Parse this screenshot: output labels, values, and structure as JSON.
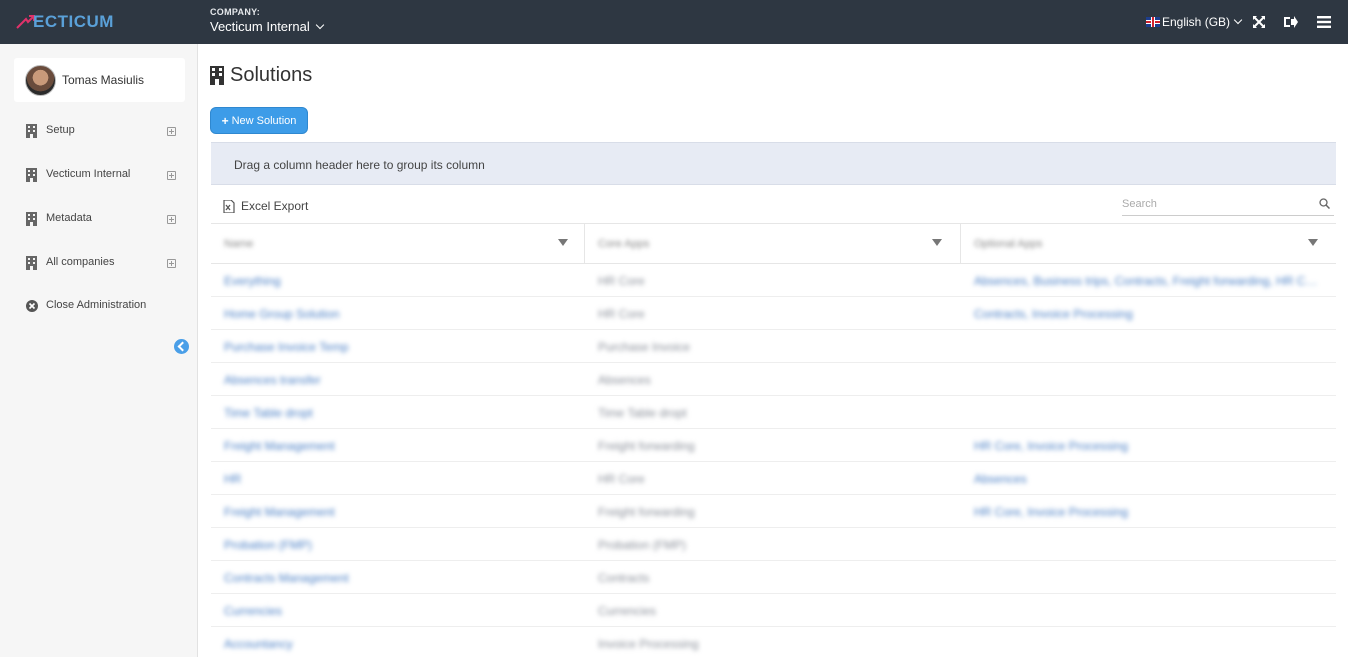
{
  "topbar": {
    "logo_text": "ECTICUM",
    "company_label": "COMPANY:",
    "company_name": "Vecticum Internal",
    "language": "English (GB)",
    "colors": {
      "bar": "#2e3742",
      "logo": "#5aa0d8",
      "logo_mark": "#e0326a"
    },
    "icons": [
      "fullscreen-icon",
      "logout-icon",
      "menu-icon"
    ]
  },
  "sidebar": {
    "user_name": "Tomas Masiulis",
    "items": [
      {
        "label": "Setup",
        "icon": "building-icon",
        "expandable": true
      },
      {
        "label": "Vecticum Internal",
        "icon": "building-icon",
        "expandable": true
      },
      {
        "label": "Metadata",
        "icon": "building-icon",
        "expandable": true
      },
      {
        "label": "All companies",
        "icon": "building-icon",
        "expandable": true
      },
      {
        "label": "Close Administration",
        "icon": "close-circle-icon",
        "expandable": false
      }
    ]
  },
  "main": {
    "title": "Solutions",
    "new_button": "New Solution",
    "group_hint": "Drag a column header here to group its column",
    "excel_export": "Excel Export",
    "search_placeholder": "Search",
    "accent_color": "#3d9ce8",
    "columns": [
      "Name",
      "Core Apps",
      "Optional Apps"
    ],
    "rows": [
      [
        "Everything",
        "HR Core",
        "Absences, Business trips, Contracts, Freight forwarding, HR Core, In..."
      ],
      [
        "Home Group Solution",
        "HR Core",
        "Contracts, Invoice Processing"
      ],
      [
        "Purchase Invoice Temp",
        "Purchase Invoice",
        ""
      ],
      [
        "Absences transfer",
        "Absences",
        ""
      ],
      [
        "Time Table dropt",
        "Time Table dropt",
        ""
      ],
      [
        "Freight Management",
        "Freight forwarding",
        "HR Core, Invoice Processing"
      ],
      [
        "HR",
        "HR Core",
        "Absences"
      ],
      [
        "Freight Management",
        "Freight forwarding",
        "HR Core, Invoice Processing"
      ],
      [
        "Probation (FMP)",
        "Probation (FMP)",
        ""
      ],
      [
        "Contracts Management",
        "Contracts",
        ""
      ],
      [
        "Currencies",
        "Currencies",
        ""
      ],
      [
        "Accountancy",
        "Invoice Processing",
        ""
      ]
    ]
  }
}
